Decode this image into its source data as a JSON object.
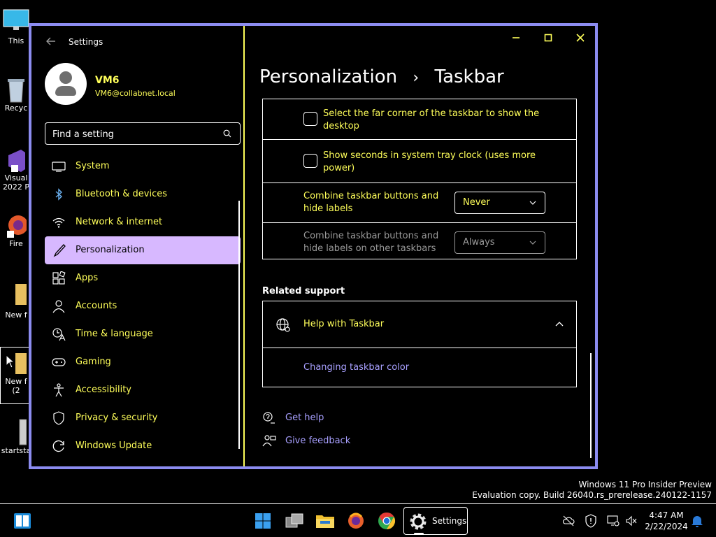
{
  "desktop": {
    "icons": [
      {
        "label1": "This",
        "label2": ""
      },
      {
        "label1": "Recyc",
        "label2": ""
      },
      {
        "label1": "Visual",
        "label2": "2022 P"
      },
      {
        "label1": "Fire",
        "label2": ""
      },
      {
        "label1": "New f",
        "label2": ""
      },
      {
        "label1": "New f",
        "label2": "(2"
      },
      {
        "label1": "startsta",
        "label2": ""
      }
    ],
    "watermark": {
      "line1": "Windows 11 Pro Insider Preview",
      "line2": "Evaluation copy. Build 26040.rs_prerelease.240122-1157"
    }
  },
  "window": {
    "app_title": "Settings",
    "controls": {
      "minimize": "—",
      "maximize": "☐",
      "close": "✕"
    },
    "user": {
      "name": "VM6",
      "email": "VM6@collabnet.local"
    },
    "search": {
      "placeholder": "Find a setting"
    },
    "nav": [
      {
        "label": "System",
        "icon": "monitor-icon"
      },
      {
        "label": "Bluetooth & devices",
        "icon": "bluetooth-icon"
      },
      {
        "label": "Network & internet",
        "icon": "wifi-icon"
      },
      {
        "label": "Personalization",
        "icon": "brush-icon",
        "active": true
      },
      {
        "label": "Apps",
        "icon": "apps-icon"
      },
      {
        "label": "Accounts",
        "icon": "person-icon"
      },
      {
        "label": "Time & language",
        "icon": "time-language-icon"
      },
      {
        "label": "Gaming",
        "icon": "gamepad-icon"
      },
      {
        "label": "Accessibility",
        "icon": "accessibility-icon"
      },
      {
        "label": "Privacy & security",
        "icon": "shield-icon"
      },
      {
        "label": "Windows Update",
        "icon": "update-icon"
      }
    ],
    "page": {
      "breadcrumb_parent": "Personalization",
      "breadcrumb_sep": "›",
      "breadcrumb_current": "Taskbar"
    },
    "settings": {
      "far_corner": {
        "line1": "Select the far corner of the taskbar to show the",
        "line2": "desktop",
        "checked": false
      },
      "seconds": {
        "line1": "Show seconds in system tray clock (uses more",
        "line2": "power)",
        "checked": false
      },
      "combine": {
        "line1": "Combine taskbar buttons and",
        "line2": "hide labels",
        "value": "Never"
      },
      "combine_other": {
        "line1": "Combine taskbar buttons and",
        "line2": "hide labels on other taskbars",
        "value": "Always"
      }
    },
    "related": {
      "heading": "Related support",
      "help_title": "Help with Taskbar",
      "help_link": "Changing taskbar color"
    },
    "footer": {
      "get_help": "Get help",
      "give_feedback": "Give feedback"
    }
  },
  "taskbar": {
    "settings_label": "Settings",
    "time": "4:47 AM",
    "date": "2/22/2024"
  }
}
